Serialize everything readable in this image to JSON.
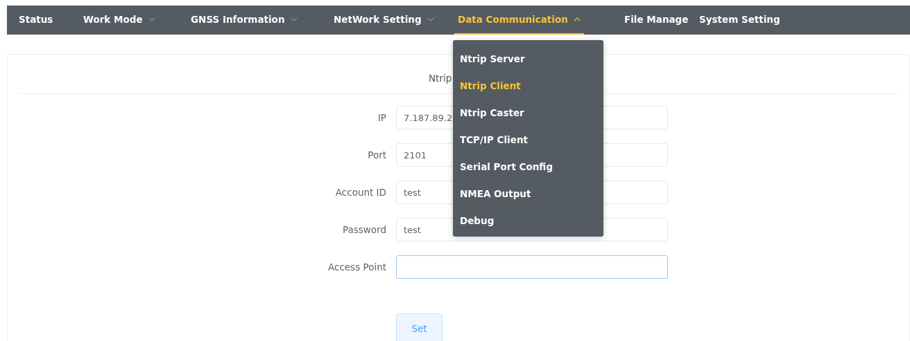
{
  "nav": [
    {
      "label": "Status",
      "selected": false
    },
    {
      "label": "Work Mode",
      "selected": false,
      "expanded": false
    },
    {
      "label": "GNSS Information",
      "selected": false,
      "expanded": false
    },
    {
      "label": "NetWork Setting",
      "selected": false,
      "expanded": false
    },
    {
      "label": "Data Communication",
      "selected": true,
      "expanded": true,
      "menu": [
        {
          "label": "Ntrip Server",
          "selected": false
        },
        {
          "label": "Ntrip Client",
          "selected": true
        },
        {
          "label": "Ntrip Caster",
          "selected": false
        },
        {
          "label": "TCP/IP Client",
          "selected": false
        },
        {
          "label": "Serial Port Config",
          "selected": false
        },
        {
          "label": "NMEA Output",
          "selected": false
        },
        {
          "label": "Debug",
          "selected": false
        }
      ]
    },
    {
      "label": "File Manage",
      "selected": false
    },
    {
      "label": "System Setting",
      "selected": false
    }
  ],
  "form": {
    "title": "Ntrip",
    "fields": [
      {
        "label": "IP",
        "value": "7.187.89.2",
        "focused": false
      },
      {
        "label": "Port",
        "value": "2101",
        "focused": false
      },
      {
        "label": "Account ID",
        "value": "test",
        "focused": false
      },
      {
        "label": "Password",
        "value": "test",
        "focused": false
      },
      {
        "label": "Access Point",
        "focused": true
      }
    ],
    "button": "Set"
  }
}
